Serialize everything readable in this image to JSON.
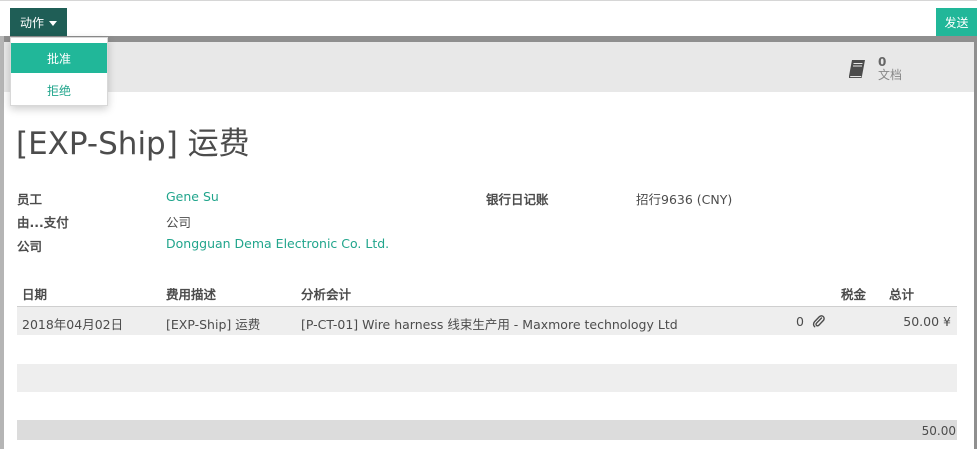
{
  "toolbar": {
    "action_label": "动作",
    "send_label": "发送",
    "action_menu": [
      "批准",
      "拒绝"
    ]
  },
  "smart_button": {
    "count": "0",
    "label": "文档"
  },
  "record": {
    "title": "[EXP-Ship] 运费",
    "fields": {
      "employee_label": "员工",
      "employee_value": "Gene Su",
      "paid_by_label": "由...支付",
      "paid_by_value": "公司",
      "company_label": "公司",
      "company_value": "Dongguan Dema Electronic Co. Ltd.",
      "journal_label": "银行日记账",
      "journal_value": "招行9636 (CNY)"
    }
  },
  "table": {
    "headers": {
      "date": "日期",
      "description": "费用描述",
      "analytic": "分析会计",
      "tax": "税金",
      "total": "总计"
    },
    "rows": [
      {
        "date": "2018年04月02日",
        "description": "[EXP-Ship] 运费",
        "analytic": "[P-CT-01] Wire harness 线束生产用 - Maxmore technology Ltd",
        "attachments": "0",
        "total": "50.00 ¥"
      }
    ],
    "footer_total": "50.00"
  },
  "colors": {
    "primary_dark": "#1f5e56",
    "accent": "#21b799",
    "link": "#21a58c"
  }
}
